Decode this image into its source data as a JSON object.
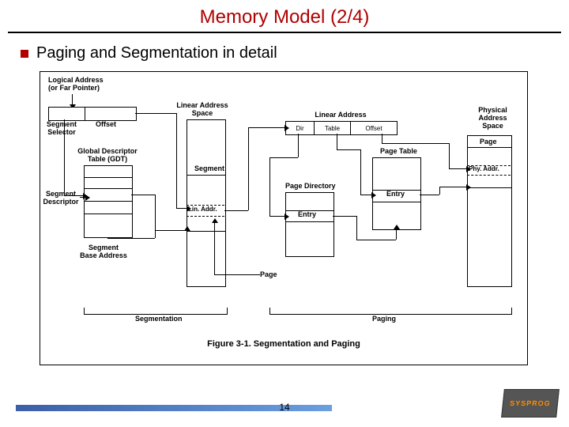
{
  "title": "Memory Model (2/4)",
  "bullet": "Paging and Segmentation in detail",
  "labels": {
    "logaddr": "Logical Address\n(or Far Pointer)",
    "segsel": "Segment\nSelector",
    "offset": "Offset",
    "linspace": "Linear Address\nSpace",
    "linear": "Linear Address",
    "dir": "Dir",
    "table": "Table",
    "off2": "Offset",
    "physspace": "Physical\nAddress\nSpace",
    "gdt": "Global Descriptor\nTable (GDT)",
    "segdesc": "Segment\nDescriptor",
    "segment": "Segment",
    "linaddr": "Lin. Addr.",
    "segbase": "Segment\nBase Address",
    "pagedir": "Page Directory",
    "pagetable": "Page Table",
    "entry": "Entry",
    "page_l": "Page",
    "page_r": "Page",
    "phyaddr": "Phy. Addr.",
    "segmentation": "Segmentation",
    "paging": "Paging",
    "figcap": "Figure 3-1. Segmentation and Paging"
  },
  "pagenum": "14",
  "logo": "SYSPROG"
}
